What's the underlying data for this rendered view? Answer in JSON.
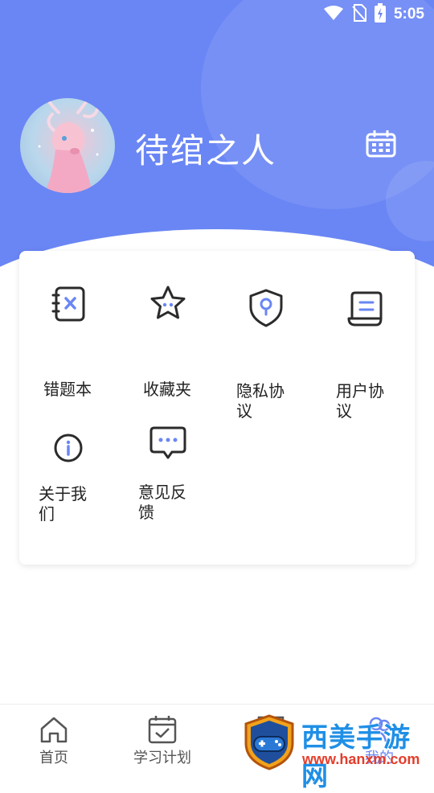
{
  "status_bar": {
    "time": "5:05"
  },
  "profile": {
    "username": "待绾之人"
  },
  "menu": {
    "items": [
      {
        "label": "错题本",
        "icon": "wrong-notebook-icon"
      },
      {
        "label": "收藏夹",
        "icon": "star-icon"
      },
      {
        "label": "隐私协议",
        "icon": "shield-icon"
      },
      {
        "label": "用户协议",
        "icon": "document-icon"
      },
      {
        "label": "关于我们",
        "icon": "info-icon"
      },
      {
        "label": "意见反馈",
        "icon": "chat-bubble-icon"
      }
    ]
  },
  "tabbar": {
    "tabs": [
      {
        "label": "首页",
        "icon": "home-icon"
      },
      {
        "label": "学习计划",
        "icon": "calendar-check-icon"
      },
      {
        "label": "",
        "icon": "book-icon"
      },
      {
        "label": "我的",
        "icon": "user-icon",
        "active": true
      }
    ]
  },
  "watermark": {
    "title": "西美手游网",
    "url": "www.hanxm.com"
  },
  "colors": {
    "accent": "#6a86f4",
    "icon_stroke": "#2b2b2b",
    "icon_accent": "#6a86f4"
  }
}
